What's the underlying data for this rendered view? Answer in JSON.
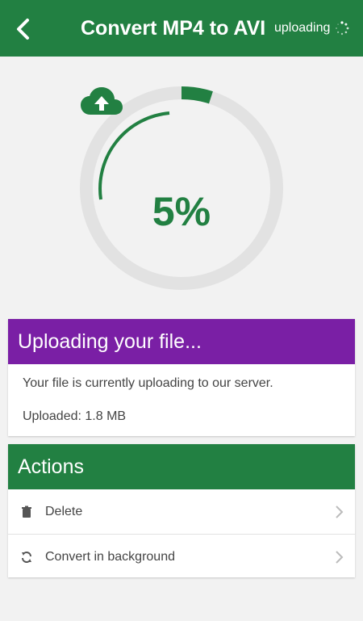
{
  "header": {
    "title": "Convert MP4 to AVI",
    "status": "uploading",
    "background_color": "#228042"
  },
  "progress": {
    "percent_label": "5%",
    "percent_value": 0.05,
    "accent_color": "#228042",
    "track_color": "#e2e2e2",
    "icon": "cloud-upload-icon"
  },
  "upload_card": {
    "title": "Uploading your file...",
    "message": "Your file is currently uploading to our server.",
    "uploaded": "Uploaded: 1.8 MB",
    "header_color": "#7a1fa5"
  },
  "actions_card": {
    "title": "Actions",
    "header_color": "#228042",
    "items": [
      {
        "label": "Delete",
        "icon": "trash-icon"
      },
      {
        "label": "Convert in background",
        "icon": "sync-icon"
      }
    ]
  }
}
